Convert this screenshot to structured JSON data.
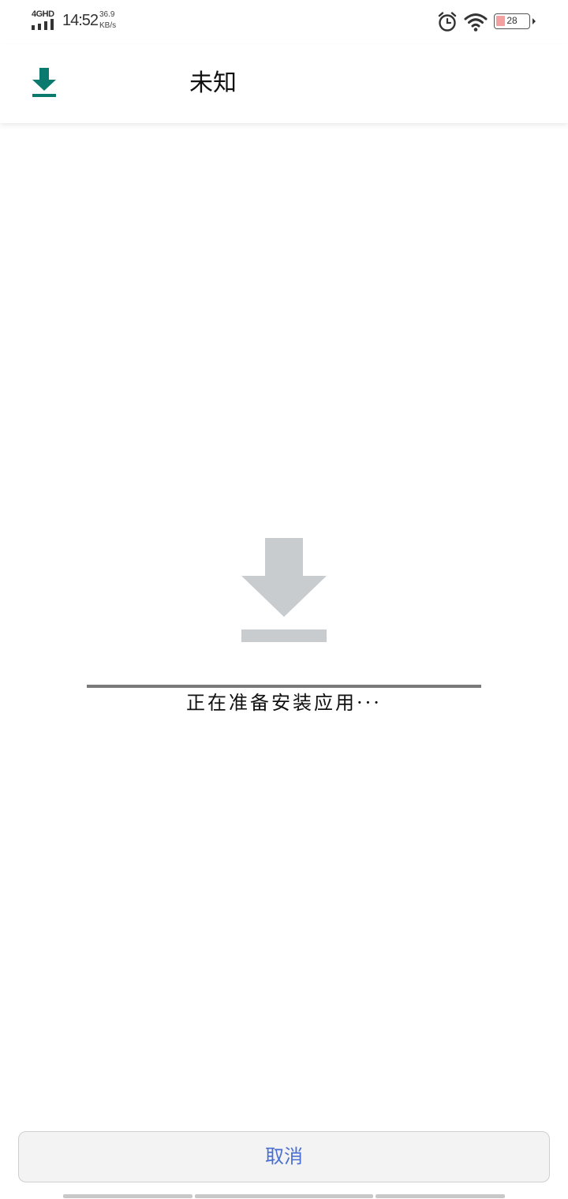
{
  "status_bar": {
    "network_type": "4GHD",
    "time": "14:52",
    "speed_value": "36.9",
    "speed_unit": "KB/s",
    "battery_level": "28",
    "icons": [
      "signal-icon",
      "alarm-icon",
      "wifi-icon",
      "battery-icon"
    ]
  },
  "app_bar": {
    "icon": "download-icon",
    "title": "未知"
  },
  "content": {
    "icon": "download-icon",
    "status_text": "正在准备安装应用···"
  },
  "footer": {
    "cancel_label": "取消"
  },
  "colors": {
    "accent": "#0b7a6e",
    "icon_gray": "#c9ccce",
    "cancel_text": "#4a6fd0",
    "battery_low": "#f4a0a0"
  }
}
